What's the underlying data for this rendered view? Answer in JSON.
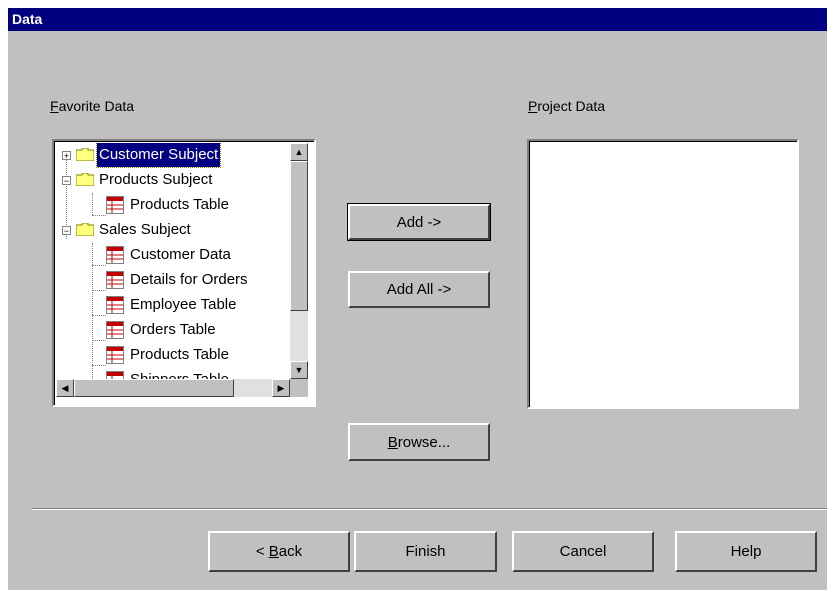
{
  "window": {
    "title": "Data"
  },
  "labels": {
    "favorite_first": "F",
    "favorite_rest": "avorite Data",
    "project_first": "P",
    "project_rest": "roject Data"
  },
  "tree": {
    "customer_subject": "Customer Subject",
    "products_subject": "Products Subject",
    "products_table": "Products Table",
    "sales_subject": "Sales Subject",
    "customer_data": "Customer Data",
    "details_for_orders": "Details for Orders",
    "employee_table": "Employee Table",
    "orders_table": "Orders Table",
    "products_table_2": "Products Table",
    "shippers_table": "Shippers Table"
  },
  "buttons": {
    "add": "Add ->",
    "add_all": "Add All ->",
    "browse_first": "B",
    "browse_rest": "rowse...",
    "back_prefix": "< ",
    "back_first": "B",
    "back_rest": "ack",
    "finish": "Finish",
    "cancel": "Cancel",
    "help": "Help"
  },
  "icons": {
    "folder": "folder-icon",
    "table": "table-icon",
    "expand": "plus-expander-icon",
    "collapse": "minus-expander-icon"
  },
  "colors": {
    "titlebar": "#000080",
    "dialog_bg": "#c0c0c0",
    "selection": "#000080",
    "folder_yellow": "#ffff80",
    "table_red": "#c00000"
  }
}
